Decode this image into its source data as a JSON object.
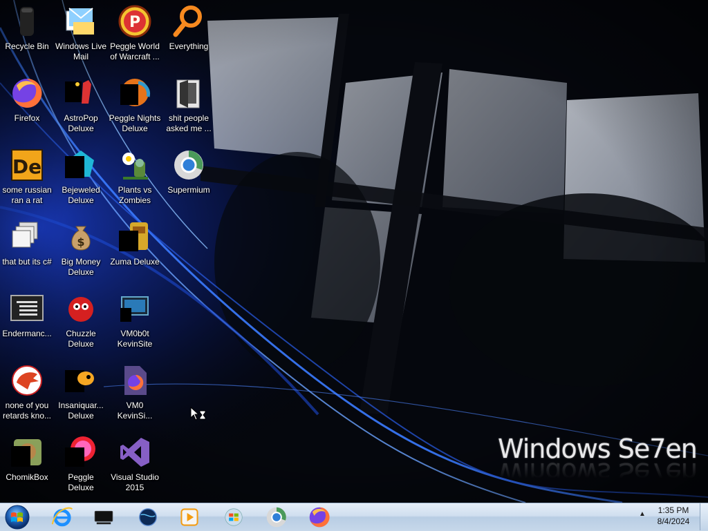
{
  "desktop": {
    "icons": [
      {
        "label": "Recycle Bin",
        "icon": "recycle-bin-icon"
      },
      {
        "label": "Windows Live Mail",
        "icon": "mail-icon"
      },
      {
        "label": "Peggle World of Warcraft ...",
        "icon": "peggle-icon"
      },
      {
        "label": "Everything",
        "icon": "magnifier-icon"
      },
      {
        "label": "Firefox",
        "icon": "firefox-icon"
      },
      {
        "label": "AstroPop Deluxe",
        "icon": "game-icon"
      },
      {
        "label": "Peggle Nights Deluxe",
        "icon": "peggle-nights-icon"
      },
      {
        "label": "shit people asked me ...",
        "icon": "folder-icon"
      },
      {
        "label": "some russian ran a rat",
        "icon": "de-app-icon"
      },
      {
        "label": "Bejeweled Deluxe",
        "icon": "gem-icon"
      },
      {
        "label": "Plants vs Zombies",
        "icon": "flower-icon"
      },
      {
        "label": "Supermium",
        "icon": "supermium-icon"
      },
      {
        "label": "that but its c#",
        "icon": "windows-stack-icon"
      },
      {
        "label": "Big Money Deluxe",
        "icon": "money-bag-icon"
      },
      {
        "label": "Zuma Deluxe",
        "icon": "zuma-icon"
      },
      {
        "label": "Endermanc...",
        "icon": "console-icon"
      },
      {
        "label": "Chuzzle Deluxe",
        "icon": "chuzzle-icon"
      },
      {
        "label": "VM0b0t KevinSite",
        "icon": "vm-icon"
      },
      {
        "label": "none of you retards kno...",
        "icon": "dragon-icon"
      },
      {
        "label": "Insaniquar... Deluxe",
        "icon": "fish-icon"
      },
      {
        "label": "VM0 KevinSi...",
        "icon": "firefox-file-icon"
      },
      {
        "label": "ChomikBox",
        "icon": "hamster-icon"
      },
      {
        "label": "Peggle Deluxe",
        "icon": "peggle-deluxe-icon"
      },
      {
        "label": "Visual Studio 2015",
        "icon": "visual-studio-icon"
      }
    ]
  },
  "watermark": {
    "text": "Windows Se7en"
  },
  "taskbar": {
    "pinned": [
      {
        "icon": "internet-explorer-icon"
      },
      {
        "icon": "monitor-icon"
      },
      {
        "icon": "globe-icon"
      },
      {
        "icon": "media-player-icon"
      },
      {
        "icon": "windows-orb-icon"
      },
      {
        "icon": "supermium-icon"
      },
      {
        "icon": "firefox-icon"
      }
    ],
    "clock": {
      "time": "1:35 PM",
      "date": "8/4/2024"
    }
  },
  "colors": {
    "taskbar_top": "#e6eef8",
    "taskbar_bottom": "#b8cde4",
    "wallpaper_base": "#04060c",
    "wallpaper_accent": "#2a6cff"
  }
}
